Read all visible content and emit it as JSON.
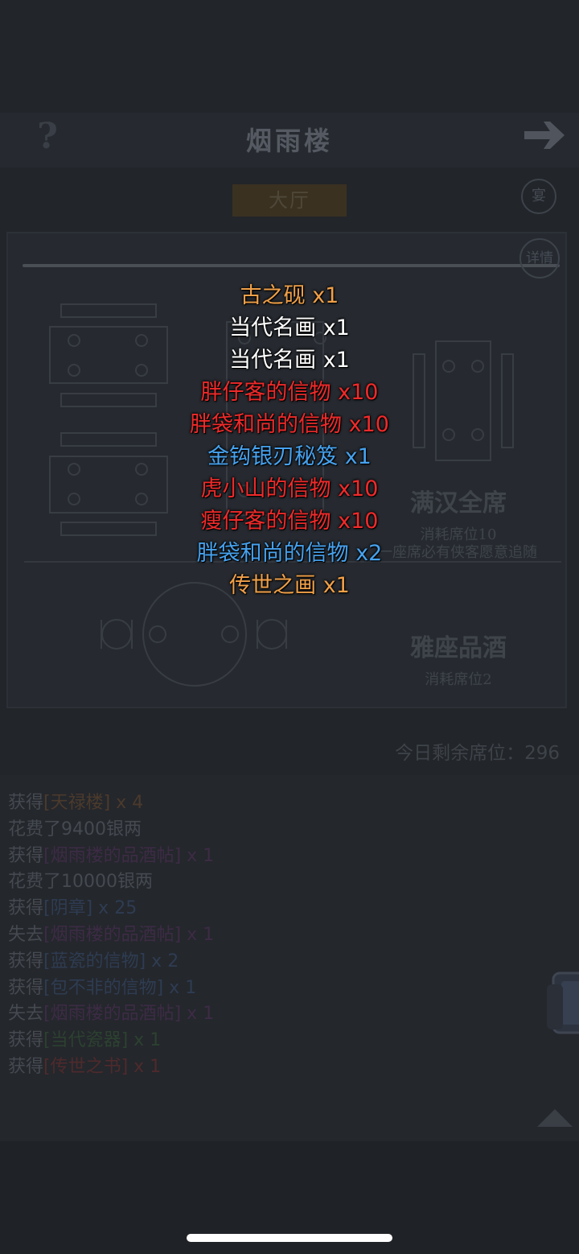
{
  "header": {
    "title": "烟雨楼",
    "help_glyph": "?",
    "next_icon": "arrow-right-icon"
  },
  "hall_tab": "大厅",
  "side_buttons": {
    "top": "宴",
    "detail": "详情"
  },
  "seat_options": [
    {
      "name": "满汉全席",
      "cost": "消耗席位10",
      "note": "一座席必有侠客愿意追随"
    },
    {
      "name": "雅座品酒",
      "cost": "消耗席位2"
    }
  ],
  "seats_remaining": "今日剩余席位：296",
  "log": [
    {
      "prefix": "获得",
      "item": "[天禄楼]",
      "qty": " x 4",
      "color": "#4b3a2c"
    },
    {
      "prefix": "花费了9400银两"
    },
    {
      "prefix": "获得",
      "item": "[烟雨楼的品酒帖]",
      "qty": " x 1",
      "color": "#3d2b45"
    },
    {
      "prefix": "花费了10000银两"
    },
    {
      "prefix": "获得",
      "item": "[阴章]",
      "qty": " x 25",
      "color": "#2e3c52"
    },
    {
      "prefix": "失去",
      "item": "[烟雨楼的品酒帖]",
      "qty": " x 1",
      "color": "#3d2b45"
    },
    {
      "prefix": "获得",
      "item": "[蓝瓷的信物]",
      "qty": " x 2",
      "color": "#2e3c52"
    },
    {
      "prefix": "获得",
      "item": "[包不非的信物]",
      "qty": " x 1",
      "color": "#2e3c52"
    },
    {
      "prefix": "失去",
      "item": "[烟雨楼的品酒帖]",
      "qty": " x 1",
      "color": "#3d2b45"
    },
    {
      "prefix": "获得",
      "item": "[当代瓷器]",
      "qty": " x 1",
      "color": "#2c4130"
    },
    {
      "prefix": "获得",
      "item": "[传世之书]",
      "qty": " x 1",
      "color": "#4e2a2c"
    }
  ],
  "rewards": [
    {
      "name": "古之砚",
      "qty": "x1",
      "color": "#f0a048"
    },
    {
      "name": "当代名画",
      "qty": "x1",
      "color": "#ffffff"
    },
    {
      "name": "当代名画",
      "qty": "x1",
      "color": "#ffffff"
    },
    {
      "name": "胖仔客的信物",
      "qty": "x10",
      "color": "#f02a2a"
    },
    {
      "name": "胖袋和尚的信物",
      "qty": "x10",
      "color": "#f02a2a"
    },
    {
      "name": "金钩银刃秘笈",
      "qty": "x1",
      "color": "#46a2ef"
    },
    {
      "name": "虎小山的信物",
      "qty": "x10",
      "color": "#f02a2a"
    },
    {
      "name": "瘦仔客的信物",
      "qty": "x10",
      "color": "#f02a2a"
    },
    {
      "name": "胖袋和尚的信物",
      "qty": "x2",
      "color": "#46a2ef"
    },
    {
      "name": "传世之画",
      "qty": "x1",
      "color": "#f0a048"
    }
  ]
}
